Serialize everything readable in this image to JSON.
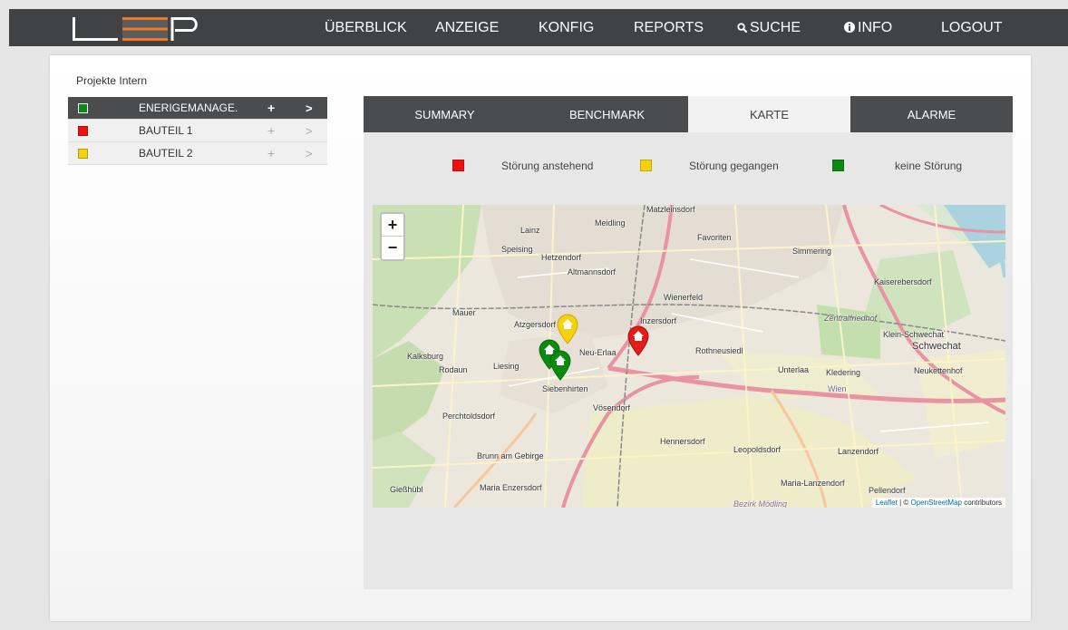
{
  "nav": {
    "items": [
      {
        "label": "ÜBERBLICK",
        "active": true
      },
      {
        "label": "ANZEIGE"
      },
      {
        "label": "KONFIG"
      },
      {
        "label": "REPORTS"
      },
      {
        "label": "SUCHE",
        "icon": "search-icon"
      },
      {
        "label": "INFO",
        "icon": "info-icon"
      },
      {
        "label": "LOGOUT"
      }
    ]
  },
  "project_title": "Projekte Intern",
  "tree": [
    {
      "label": "ENERIGEMANAGE...",
      "status_color": "#0b8a12",
      "selected": true
    },
    {
      "label": "BAUTEIL 1",
      "status_color": "#ee1111"
    },
    {
      "label": "BAUTEIL 2",
      "status_color": "#f5d20c"
    }
  ],
  "tree_add_symbol": "+",
  "tree_open_symbol": ">",
  "tabs": [
    {
      "label": "SUMMARY"
    },
    {
      "label": "BENCHMARK"
    },
    {
      "label": "KARTE",
      "active": true
    },
    {
      "label": "ALARME"
    }
  ],
  "legend": [
    {
      "label": "Störung anstehend",
      "color": "#ee1111"
    },
    {
      "label": "Störung gegangen",
      "color": "#f5d20c"
    },
    {
      "label": "keine Störung",
      "color": "#0b8a12"
    }
  ],
  "map": {
    "zoom_in": "+",
    "zoom_out": "−",
    "places": [
      "Matzleinsdorf",
      "Lainz",
      "Meidling",
      "Favoriten",
      "Speising",
      "Hetzendorf",
      "Simmering",
      "Altmannsdorf",
      "Kaiserebersdorf",
      "Wienerfeld",
      "Zentralfriedhof",
      "Mauer",
      "Atzgersdorf",
      "Inzersdorf",
      "Klein-Schwechat",
      "Schwechat",
      "Kalksburg",
      "Neu-Erlaa",
      "Rothneusiedl",
      "Rodaun",
      "Liesing",
      "Unterlaa",
      "Kledering",
      "Neukettenhof",
      "Siebenhirten",
      "Wien",
      "Perchtoldsdorf",
      "Vösendorf",
      "Hennersdorf",
      "Leopoldsdorf",
      "Lanzendorf",
      "Brunn am Gebirge",
      "Maria Enzersdorf",
      "Gießhübl",
      "Maria-Lanzendorf",
      "Pellendorf",
      "Bezirk Mödling"
    ],
    "markers": [
      {
        "status_color": "#f5d20c"
      },
      {
        "status_color": "#ee1111"
      },
      {
        "status_color": "#0b8a12"
      },
      {
        "status_color": "#0b8a12"
      }
    ],
    "attribution": {
      "leaflet": "Leaflet",
      "sep": " | © ",
      "osm": "OpenStreetMap",
      "suffix": " contributors"
    }
  },
  "colors": {
    "accent": "#f07a28",
    "navbar": "#404244",
    "tab_dark": "#4a4c4e"
  }
}
